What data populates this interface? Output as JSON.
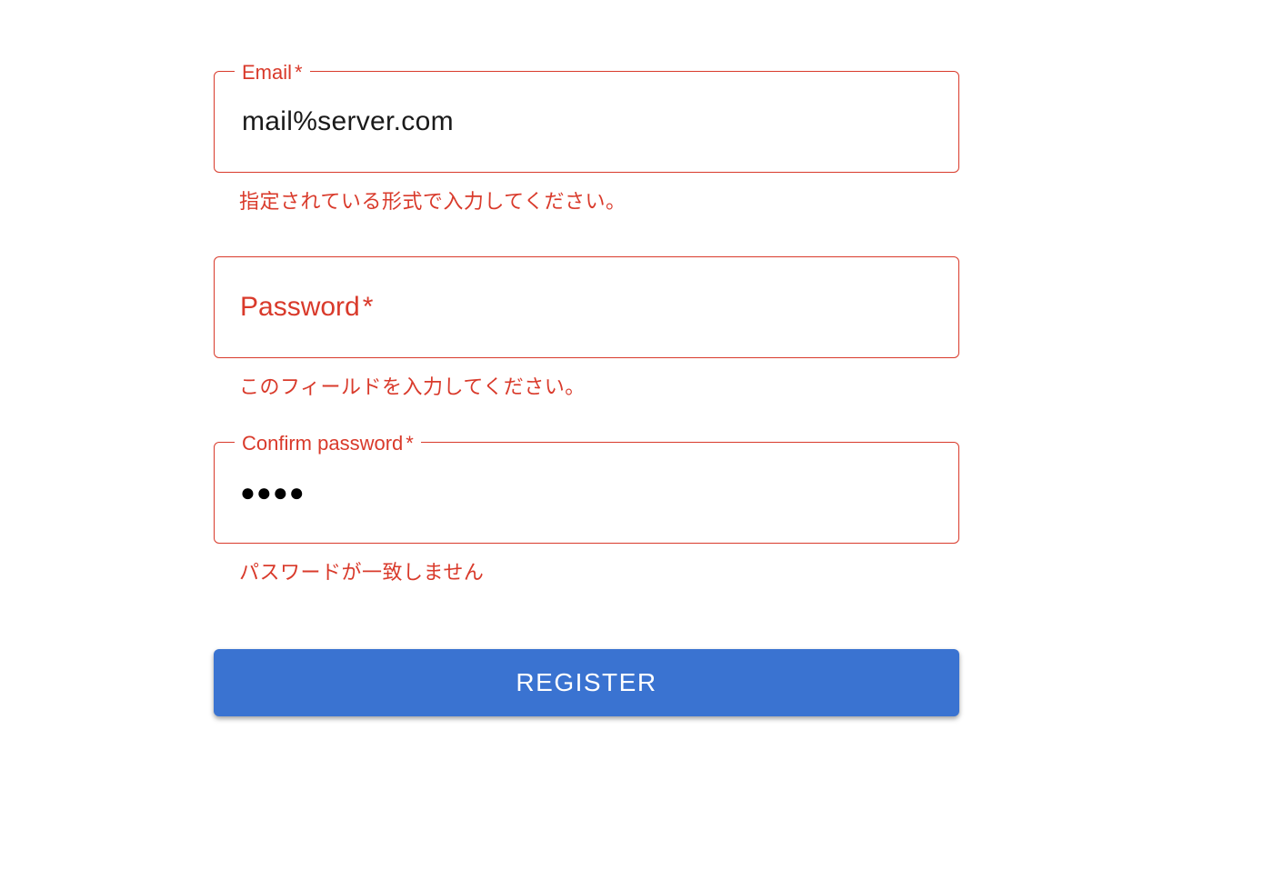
{
  "form": {
    "email": {
      "label": "Email",
      "asterisk": "*",
      "value": "mail%server.com",
      "helper": "指定されている形式で入力してください。"
    },
    "password": {
      "label": "Password",
      "asterisk": "*",
      "value": "",
      "helper": "このフィールドを入力してください。"
    },
    "confirm": {
      "label": "Confirm password",
      "asterisk": "*",
      "value_mask": "●●●●",
      "helper": "パスワードが一致しません"
    },
    "register_label": "REGISTER"
  },
  "colors": {
    "error": "#d93a2b",
    "button": "#3a73d1"
  }
}
